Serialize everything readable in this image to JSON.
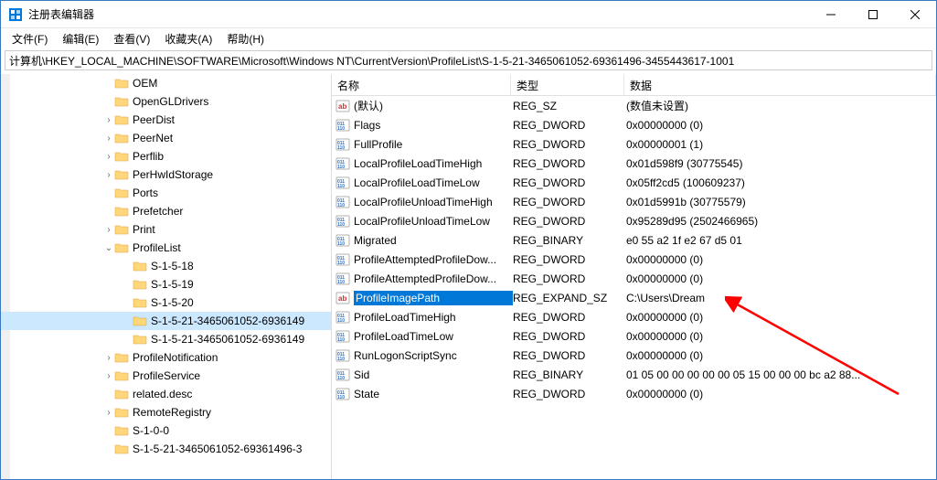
{
  "window": {
    "title": "注册表编辑器"
  },
  "menu": {
    "file": "文件(F)",
    "edit": "编辑(E)",
    "view": "查看(V)",
    "favorites": "收藏夹(A)",
    "help": "帮助(H)"
  },
  "address": "计算机\\HKEY_LOCAL_MACHINE\\SOFTWARE\\Microsoft\\Windows NT\\CurrentVersion\\ProfileList\\S-1-5-21-3465061052-69361496-3455443617-1001",
  "columns": {
    "name": "名称",
    "type": "类型",
    "data": "数据"
  },
  "tree": [
    {
      "label": "OEM",
      "indent": 112,
      "exp": ""
    },
    {
      "label": "OpenGLDrivers",
      "indent": 112,
      "exp": ""
    },
    {
      "label": "PeerDist",
      "indent": 112,
      "exp": ">"
    },
    {
      "label": "PeerNet",
      "indent": 112,
      "exp": ">"
    },
    {
      "label": "Perflib",
      "indent": 112,
      "exp": ">"
    },
    {
      "label": "PerHwIdStorage",
      "indent": 112,
      "exp": ">"
    },
    {
      "label": "Ports",
      "indent": 112,
      "exp": ""
    },
    {
      "label": "Prefetcher",
      "indent": 112,
      "exp": ""
    },
    {
      "label": "Print",
      "indent": 112,
      "exp": ">"
    },
    {
      "label": "ProfileList",
      "indent": 112,
      "exp": "v"
    },
    {
      "label": "S-1-5-18",
      "indent": 132,
      "exp": ""
    },
    {
      "label": "S-1-5-19",
      "indent": 132,
      "exp": ""
    },
    {
      "label": "S-1-5-20",
      "indent": 132,
      "exp": ""
    },
    {
      "label": "S-1-5-21-3465061052-6936149",
      "indent": 132,
      "exp": "",
      "selected": true
    },
    {
      "label": "S-1-5-21-3465061052-6936149",
      "indent": 132,
      "exp": ""
    },
    {
      "label": "ProfileNotification",
      "indent": 112,
      "exp": ">"
    },
    {
      "label": "ProfileService",
      "indent": 112,
      "exp": ">"
    },
    {
      "label": "related.desc",
      "indent": 112,
      "exp": ""
    },
    {
      "label": "RemoteRegistry",
      "indent": 112,
      "exp": ">"
    },
    {
      "label": "S-1-0-0",
      "indent": 112,
      "exp": ""
    },
    {
      "label": "S-1-5-21-3465061052-69361496-3",
      "indent": 112,
      "exp": ""
    }
  ],
  "values": [
    {
      "icon": "sz",
      "name": "(默认)",
      "type": "REG_SZ",
      "data": "(数值未设置)"
    },
    {
      "icon": "bin",
      "name": "Flags",
      "type": "REG_DWORD",
      "data": "0x00000000 (0)"
    },
    {
      "icon": "bin",
      "name": "FullProfile",
      "type": "REG_DWORD",
      "data": "0x00000001 (1)"
    },
    {
      "icon": "bin",
      "name": "LocalProfileLoadTimeHigh",
      "type": "REG_DWORD",
      "data": "0x01d598f9 (30775545)"
    },
    {
      "icon": "bin",
      "name": "LocalProfileLoadTimeLow",
      "type": "REG_DWORD",
      "data": "0x05ff2cd5 (100609237)"
    },
    {
      "icon": "bin",
      "name": "LocalProfileUnloadTimeHigh",
      "type": "REG_DWORD",
      "data": "0x01d5991b (30775579)"
    },
    {
      "icon": "bin",
      "name": "LocalProfileUnloadTimeLow",
      "type": "REG_DWORD",
      "data": "0x95289d95 (2502466965)"
    },
    {
      "icon": "bin",
      "name": "Migrated",
      "type": "REG_BINARY",
      "data": "e0 55 a2 1f e2 67 d5 01"
    },
    {
      "icon": "bin",
      "name": "ProfileAttemptedProfileDow...",
      "type": "REG_DWORD",
      "data": "0x00000000 (0)"
    },
    {
      "icon": "bin",
      "name": "ProfileAttemptedProfileDow...",
      "type": "REG_DWORD",
      "data": "0x00000000 (0)"
    },
    {
      "icon": "sz",
      "name": "ProfileImagePath",
      "type": "REG_EXPAND_SZ",
      "data": "C:\\Users\\Dream",
      "selected": true
    },
    {
      "icon": "bin",
      "name": "ProfileLoadTimeHigh",
      "type": "REG_DWORD",
      "data": "0x00000000 (0)"
    },
    {
      "icon": "bin",
      "name": "ProfileLoadTimeLow",
      "type": "REG_DWORD",
      "data": "0x00000000 (0)"
    },
    {
      "icon": "bin",
      "name": "RunLogonScriptSync",
      "type": "REG_DWORD",
      "data": "0x00000000 (0)"
    },
    {
      "icon": "bin",
      "name": "Sid",
      "type": "REG_BINARY",
      "data": "01 05 00 00 00 00 00 05 15 00 00 00 bc a2 88..."
    },
    {
      "icon": "bin",
      "name": "State",
      "type": "REG_DWORD",
      "data": "0x00000000 (0)"
    }
  ]
}
